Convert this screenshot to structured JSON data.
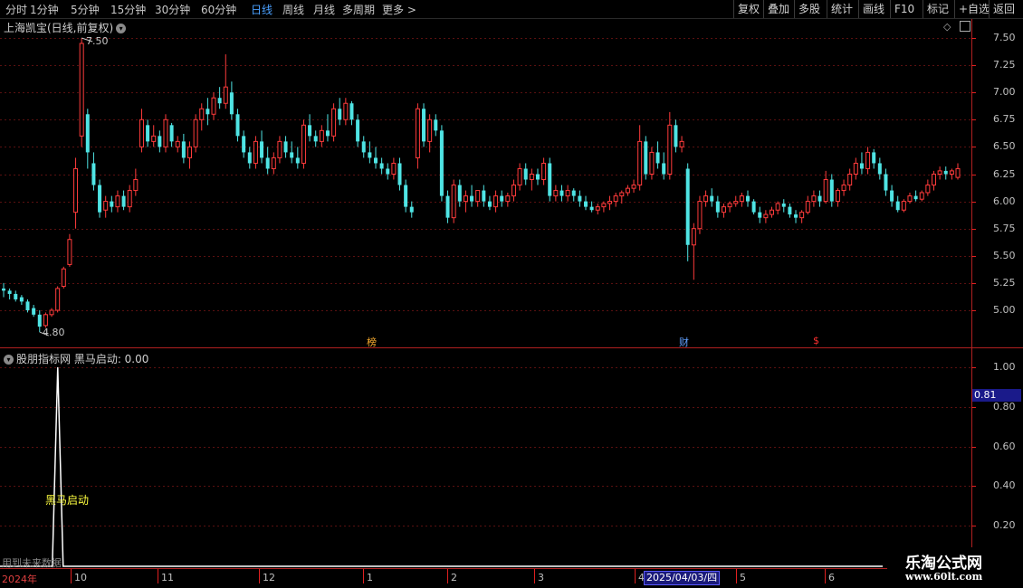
{
  "toolbar": {
    "periods": [
      "分时",
      "1分钟",
      "5分钟",
      "15分钟",
      "30分钟",
      "60分钟",
      "日线",
      "周线",
      "月线",
      "多周期",
      "更多 >"
    ],
    "active_period": "日线",
    "right_buttons": [
      "复权",
      "叠加",
      "多股",
      "统计",
      "画线",
      "F10",
      "标记",
      "+自选",
      "返回"
    ]
  },
  "main_chart": {
    "title": "上海凯宝(日线,前复权)",
    "high_label": "7.50",
    "low_label": "4.80",
    "y_ticks": [
      "7.50",
      "7.25",
      "7.00",
      "6.75",
      "6.50",
      "6.25",
      "6.00",
      "5.75",
      "5.50",
      "5.25",
      "5.00"
    ],
    "markers": [
      {
        "text": "榜",
        "color": "#ffb030"
      },
      {
        "text": "财",
        "color": "#60a0ff"
      },
      {
        "text": "$",
        "color": "#ff3030"
      }
    ],
    "up_color": "#ff3b3b",
    "down_color": "#4fe4e4"
  },
  "indicator": {
    "title": "股朋指标网 黑马启动: 0.00",
    "y_ticks": [
      "1.00",
      "0.80",
      "0.60",
      "0.40",
      "0.20"
    ],
    "current_value": "0.81",
    "signal_label": "黑马启动",
    "future_note": "用到未来数据"
  },
  "date_axis": {
    "year": "2024年",
    "months": [
      "10",
      "11",
      "12",
      "1",
      "2",
      "3",
      "4",
      "5",
      "6"
    ],
    "cursor_date": "2025/04/03/四"
  },
  "watermark": {
    "line1": "乐淘公式网",
    "line2": "www.60lt.com"
  },
  "chart_data": {
    "type": "candlestick",
    "ylim": [
      4.7,
      7.6
    ],
    "candles": [
      [
        5.2,
        5.25,
        5.12,
        5.18
      ],
      [
        5.18,
        5.2,
        5.1,
        5.15
      ],
      [
        5.15,
        5.18,
        5.08,
        5.1
      ],
      [
        5.12,
        5.14,
        5.05,
        5.08
      ],
      [
        5.08,
        5.1,
        4.98,
        5.0
      ],
      [
        5.02,
        5.05,
        4.94,
        4.96
      ],
      [
        4.96,
        5.0,
        4.8,
        4.85
      ],
      [
        4.86,
        4.98,
        4.84,
        4.96
      ],
      [
        4.96,
        5.02,
        4.94,
        5.0
      ],
      [
        5.0,
        5.22,
        4.98,
        5.2
      ],
      [
        5.22,
        5.4,
        5.2,
        5.38
      ],
      [
        5.42,
        5.7,
        5.4,
        5.65
      ],
      [
        5.9,
        6.4,
        5.75,
        6.3
      ],
      [
        6.6,
        7.5,
        6.5,
        7.45
      ],
      [
        6.8,
        6.85,
        6.3,
        6.45
      ],
      [
        6.35,
        6.45,
        6.1,
        6.15
      ],
      [
        6.15,
        6.2,
        5.85,
        5.9
      ],
      [
        5.92,
        6.05,
        5.85,
        6.0
      ],
      [
        6.0,
        6.05,
        5.9,
        5.95
      ],
      [
        5.95,
        6.1,
        5.9,
        6.05
      ],
      [
        6.05,
        6.1,
        5.92,
        5.95
      ],
      [
        5.95,
        6.15,
        5.9,
        6.1
      ],
      [
        6.1,
        6.3,
        6.05,
        6.2
      ],
      [
        6.5,
        6.85,
        6.45,
        6.75
      ],
      [
        6.7,
        6.75,
        6.5,
        6.55
      ],
      [
        6.55,
        6.7,
        6.5,
        6.6
      ],
      [
        6.6,
        6.65,
        6.45,
        6.5
      ],
      [
        6.5,
        6.8,
        6.45,
        6.75
      ],
      [
        6.7,
        6.72,
        6.5,
        6.55
      ],
      [
        6.5,
        6.6,
        6.45,
        6.55
      ],
      [
        6.55,
        6.62,
        6.35,
        6.4
      ],
      [
        6.4,
        6.55,
        6.3,
        6.5
      ],
      [
        6.5,
        6.8,
        6.45,
        6.75
      ],
      [
        6.75,
        6.9,
        6.65,
        6.85
      ],
      [
        6.85,
        6.95,
        6.7,
        6.8
      ],
      [
        6.8,
        7.0,
        6.75,
        6.95
      ],
      [
        6.95,
        7.05,
        6.85,
        6.9
      ],
      [
        6.9,
        7.35,
        6.85,
        7.05
      ],
      [
        7.0,
        7.1,
        6.75,
        6.8
      ],
      [
        6.8,
        6.85,
        6.55,
        6.6
      ],
      [
        6.6,
        6.65,
        6.4,
        6.45
      ],
      [
        6.45,
        6.5,
        6.3,
        6.35
      ],
      [
        6.35,
        6.6,
        6.3,
        6.55
      ],
      [
        6.55,
        6.65,
        6.35,
        6.4
      ],
      [
        6.4,
        6.5,
        6.25,
        6.3
      ],
      [
        6.3,
        6.45,
        6.25,
        6.4
      ],
      [
        6.4,
        6.6,
        6.35,
        6.55
      ],
      [
        6.55,
        6.6,
        6.4,
        6.45
      ],
      [
        6.45,
        6.55,
        6.35,
        6.4
      ],
      [
        6.4,
        6.5,
        6.3,
        6.35
      ],
      [
        6.35,
        6.75,
        6.3,
        6.7
      ],
      [
        6.7,
        6.8,
        6.55,
        6.6
      ],
      [
        6.6,
        6.65,
        6.5,
        6.55
      ],
      [
        6.55,
        6.7,
        6.5,
        6.65
      ],
      [
        6.65,
        6.8,
        6.55,
        6.6
      ],
      [
        6.6,
        6.9,
        6.55,
        6.85
      ],
      [
        6.85,
        6.95,
        6.7,
        6.75
      ],
      [
        6.75,
        6.95,
        6.7,
        6.9
      ],
      [
        6.9,
        6.92,
        6.7,
        6.75
      ],
      [
        6.75,
        6.8,
        6.5,
        6.55
      ],
      [
        6.55,
        6.6,
        6.4,
        6.45
      ],
      [
        6.45,
        6.55,
        6.35,
        6.4
      ],
      [
        6.4,
        6.5,
        6.3,
        6.35
      ],
      [
        6.35,
        6.4,
        6.25,
        6.3
      ],
      [
        6.3,
        6.35,
        6.2,
        6.25
      ],
      [
        6.25,
        6.4,
        6.2,
        6.35
      ],
      [
        6.35,
        6.4,
        6.1,
        6.15
      ],
      [
        6.15,
        6.2,
        5.9,
        5.95
      ],
      [
        5.95,
        6.0,
        5.85,
        5.9
      ],
      [
        6.4,
        6.9,
        6.3,
        6.85
      ],
      [
        6.85,
        6.9,
        6.5,
        6.55
      ],
      [
        6.55,
        6.8,
        6.45,
        6.75
      ],
      [
        6.75,
        6.8,
        6.6,
        6.65
      ],
      [
        6.65,
        6.7,
        6.0,
        6.05
      ],
      [
        6.05,
        6.1,
        5.8,
        5.85
      ],
      [
        5.85,
        6.2,
        5.8,
        6.15
      ],
      [
        6.15,
        6.2,
        5.95,
        6.0
      ],
      [
        6.0,
        6.1,
        5.9,
        6.05
      ],
      [
        6.05,
        6.15,
        5.95,
        6.0
      ],
      [
        6.0,
        6.1,
        5.95,
        6.1
      ],
      [
        6.1,
        6.15,
        5.95,
        6.0
      ],
      [
        6.0,
        6.05,
        5.92,
        5.95
      ],
      [
        5.95,
        6.1,
        5.9,
        6.05
      ],
      [
        6.05,
        6.1,
        5.95,
        6.0
      ],
      [
        6.0,
        6.08,
        5.95,
        6.05
      ],
      [
        6.05,
        6.2,
        6.0,
        6.15
      ],
      [
        6.15,
        6.35,
        6.1,
        6.3
      ],
      [
        6.3,
        6.35,
        6.15,
        6.2
      ],
      [
        6.2,
        6.3,
        6.1,
        6.25
      ],
      [
        6.25,
        6.3,
        6.15,
        6.2
      ],
      [
        6.2,
        6.4,
        6.15,
        6.35
      ],
      [
        6.35,
        6.4,
        6.0,
        6.05
      ],
      [
        6.05,
        6.15,
        6.0,
        6.1
      ],
      [
        6.1,
        6.15,
        6.0,
        6.05
      ],
      [
        6.05,
        6.15,
        6.0,
        6.1
      ],
      [
        6.1,
        6.12,
        6.0,
        6.05
      ],
      [
        6.05,
        6.1,
        5.95,
        6.0
      ],
      [
        6.0,
        6.05,
        5.92,
        5.95
      ],
      [
        5.95,
        6.0,
        5.9,
        5.92
      ],
      [
        5.92,
        5.98,
        5.88,
        5.95
      ],
      [
        5.95,
        6.0,
        5.9,
        5.98
      ],
      [
        5.98,
        6.05,
        5.92,
        6.0
      ],
      [
        6.0,
        6.08,
        5.95,
        6.05
      ],
      [
        6.05,
        6.1,
        5.98,
        6.08
      ],
      [
        6.08,
        6.15,
        6.05,
        6.12
      ],
      [
        6.12,
        6.2,
        6.08,
        6.15
      ],
      [
        6.15,
        6.7,
        6.1,
        6.55
      ],
      [
        6.55,
        6.6,
        6.2,
        6.25
      ],
      [
        6.25,
        6.5,
        6.2,
        6.45
      ],
      [
        6.45,
        6.55,
        6.3,
        6.35
      ],
      [
        6.35,
        6.45,
        6.2,
        6.25
      ],
      [
        6.25,
        6.82,
        6.2,
        6.7
      ],
      [
        6.7,
        6.75,
        6.45,
        6.5
      ],
      [
        6.5,
        6.6,
        6.45,
        6.55
      ],
      [
        6.3,
        6.35,
        5.45,
        5.6
      ],
      [
        5.6,
        5.8,
        5.28,
        5.75
      ],
      [
        5.75,
        6.05,
        5.7,
        6.0
      ],
      [
        6.0,
        6.1,
        5.95,
        6.05
      ],
      [
        6.05,
        6.12,
        5.95,
        6.0
      ],
      [
        6.0,
        6.05,
        5.85,
        5.9
      ],
      [
        5.9,
        5.98,
        5.85,
        5.95
      ],
      [
        5.95,
        6.0,
        5.9,
        5.98
      ],
      [
        5.98,
        6.05,
        5.95,
        6.0
      ],
      [
        6.0,
        6.08,
        5.95,
        6.05
      ],
      [
        6.05,
        6.1,
        5.95,
        6.0
      ],
      [
        6.0,
        6.02,
        5.88,
        5.9
      ],
      [
        5.9,
        5.95,
        5.8,
        5.85
      ],
      [
        5.85,
        5.92,
        5.8,
        5.88
      ],
      [
        5.88,
        5.95,
        5.85,
        5.92
      ],
      [
        5.92,
        6.0,
        5.88,
        5.98
      ],
      [
        5.98,
        6.02,
        5.9,
        5.95
      ],
      [
        5.95,
        5.98,
        5.85,
        5.88
      ],
      [
        5.88,
        5.92,
        5.8,
        5.85
      ],
      [
        5.85,
        5.92,
        5.8,
        5.9
      ],
      [
        5.9,
        6.05,
        5.88,
        6.0
      ],
      [
        6.0,
        6.1,
        5.95,
        6.05
      ],
      [
        6.05,
        6.1,
        5.95,
        6.0
      ],
      [
        6.0,
        6.28,
        5.98,
        6.2
      ],
      [
        6.2,
        6.25,
        5.95,
        6.0
      ],
      [
        6.0,
        6.12,
        5.95,
        6.1
      ],
      [
        6.1,
        6.2,
        6.05,
        6.15
      ],
      [
        6.15,
        6.3,
        6.1,
        6.25
      ],
      [
        6.25,
        6.4,
        6.2,
        6.35
      ],
      [
        6.35,
        6.45,
        6.25,
        6.3
      ],
      [
        6.3,
        6.5,
        6.25,
        6.45
      ],
      [
        6.45,
        6.48,
        6.3,
        6.35
      ],
      [
        6.35,
        6.4,
        6.2,
        6.25
      ],
      [
        6.25,
        6.3,
        6.05,
        6.1
      ],
      [
        6.1,
        6.15,
        5.95,
        6.0
      ],
      [
        6.0,
        6.05,
        5.9,
        5.92
      ],
      [
        5.92,
        6.02,
        5.9,
        6.0
      ],
      [
        6.0,
        6.08,
        5.98,
        6.05
      ],
      [
        6.05,
        6.1,
        6.0,
        6.02
      ],
      [
        6.02,
        6.1,
        6.0,
        6.08
      ],
      [
        6.08,
        6.2,
        6.05,
        6.15
      ],
      [
        6.15,
        6.28,
        6.1,
        6.25
      ],
      [
        6.25,
        6.32,
        6.2,
        6.28
      ],
      [
        6.28,
        6.32,
        6.2,
        6.25
      ],
      [
        6.25,
        6.3,
        6.2,
        6.28
      ],
      [
        6.22,
        6.35,
        6.2,
        6.3
      ]
    ],
    "indicator_series": {
      "name": "黑马启动",
      "spike_index": 6,
      "spike_value": 1.0,
      "baseline": 0.0
    }
  }
}
